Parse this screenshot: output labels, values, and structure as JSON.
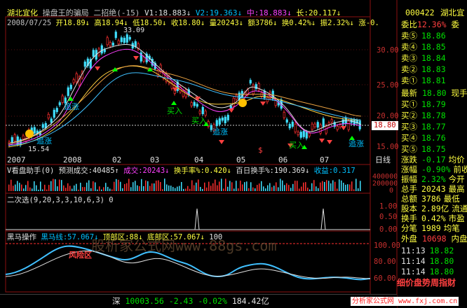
{
  "header": {
    "stock_name": "湖北宜化",
    "indicator": "操盘王的骗局",
    "strategy": "二招绝(-15)",
    "v1": "V1:18.883↓",
    "v2": "V2:19.363↓",
    "mid": "中:18.883↓",
    "long": "长:20.117↓",
    "date": "2008/07/25",
    "open": "开18.89↓",
    "high": "高18.94↓",
    "low": "低18.50↓",
    "close": "收18.80↓",
    "volume": "量20243↓",
    "amount": "额3786↓",
    "turnover": "换0.42%↓",
    "amplitude": "振2.32%↓",
    "change": "涨-0."
  },
  "main_chart": {
    "price_labels": [
      "30.00",
      "25.00",
      "20.00",
      "15.00"
    ],
    "current_price": "18.80",
    "high_mark": "33.09",
    "low_mark": "15.54",
    "annotations": [
      "追涨",
      "追涨",
      "买入",
      "买入",
      "追涨",
      "追涨",
      "买入",
      "追涨",
      "$"
    ],
    "x_labels": [
      "2007",
      "2008",
      "02",
      "03",
      "04",
      "05",
      "06",
      "07"
    ],
    "period": "日线"
  },
  "volume_panel": {
    "title": "V看盘助手(0)",
    "predict": "预测成交:40485↑",
    "volume": "成交:20243↓",
    "turnover": "换手率%:0.420↓",
    "hundred_day": "百日换手%:190.369↓",
    "profit": "收益:0.317",
    "scale": [
      "400000",
      "200000",
      "0"
    ]
  },
  "second_panel": {
    "title": "二次选(9,20,3,3,10,6,3) 0",
    "scale": [
      "1.00",
      "0.50",
      "0.00"
    ]
  },
  "horse_panel": {
    "title": "黑马操作",
    "line": "黑马线:57.067↓",
    "top": "顶部区:88↓",
    "bottom": "底部区:57.067↓",
    "val": "100",
    "warn": "风险区",
    "scale": [
      "100.00",
      "80.00",
      "60.00"
    ],
    "watermark": "股析家公式网www.88gs.com"
  },
  "status_bar": {
    "index_name": "深",
    "index_value": "10003.56",
    "index_change": "-2.43",
    "index_pct": "-0.02%",
    "index_amount": "184.42亿"
  },
  "side_panel": {
    "code": "000422",
    "name": "湖北宜",
    "weibi_label": "委比",
    "weibi": "12.36%",
    "weicha_label": "委",
    "sell": [
      {
        "label": "卖⑤",
        "price": "18.86"
      },
      {
        "label": "卖④",
        "price": "18.85"
      },
      {
        "label": "卖③",
        "price": "18.84"
      },
      {
        "label": "卖②",
        "price": "18.83"
      },
      {
        "label": "卖①",
        "price": "18.81"
      }
    ],
    "latest_label": "最新",
    "latest": "18.80",
    "latest_right": "现手",
    "buy": [
      {
        "label": "买①",
        "price": "18.79"
      },
      {
        "label": "买②",
        "price": "18.78"
      },
      {
        "label": "买③",
        "price": "18.77"
      },
      {
        "label": "买④",
        "price": "18.76"
      },
      {
        "label": "买⑤",
        "price": "18.75"
      }
    ],
    "stats": [
      {
        "label": "涨跌",
        "value": "-0.17",
        "right": "均价"
      },
      {
        "label": "涨幅",
        "value": "-0.90%",
        "right": "前收"
      },
      {
        "label": "振幅",
        "value": "2.32%",
        "right": "今开"
      },
      {
        "label": "总手",
        "value": "20243",
        "right": "最高"
      },
      {
        "label": "总额",
        "value": "3786",
        "right": "最低"
      },
      {
        "label": "股本",
        "value": "2.89亿",
        "right": "流通"
      },
      {
        "label": "换手",
        "value": "0.42%",
        "right": "市盈"
      },
      {
        "label": "分笔",
        "value": "1989",
        "right": "均笔"
      }
    ],
    "outer_label": "外盘",
    "outer": "10698",
    "inner_label": "内盘",
    "ticks": [
      {
        "time": "11:13",
        "price": "18.82"
      },
      {
        "time": "11:14",
        "price": "18.80"
      },
      {
        "time": "11:14",
        "price": "18.80"
      }
    ],
    "bottom_text": "细价盘势周指财",
    "watermark": "分析家公式网 www.fxj.com.cn"
  },
  "colors": {
    "up": "#ff3030",
    "down": "#00ffff",
    "bg": "#000000",
    "grid": "#8b0000"
  }
}
